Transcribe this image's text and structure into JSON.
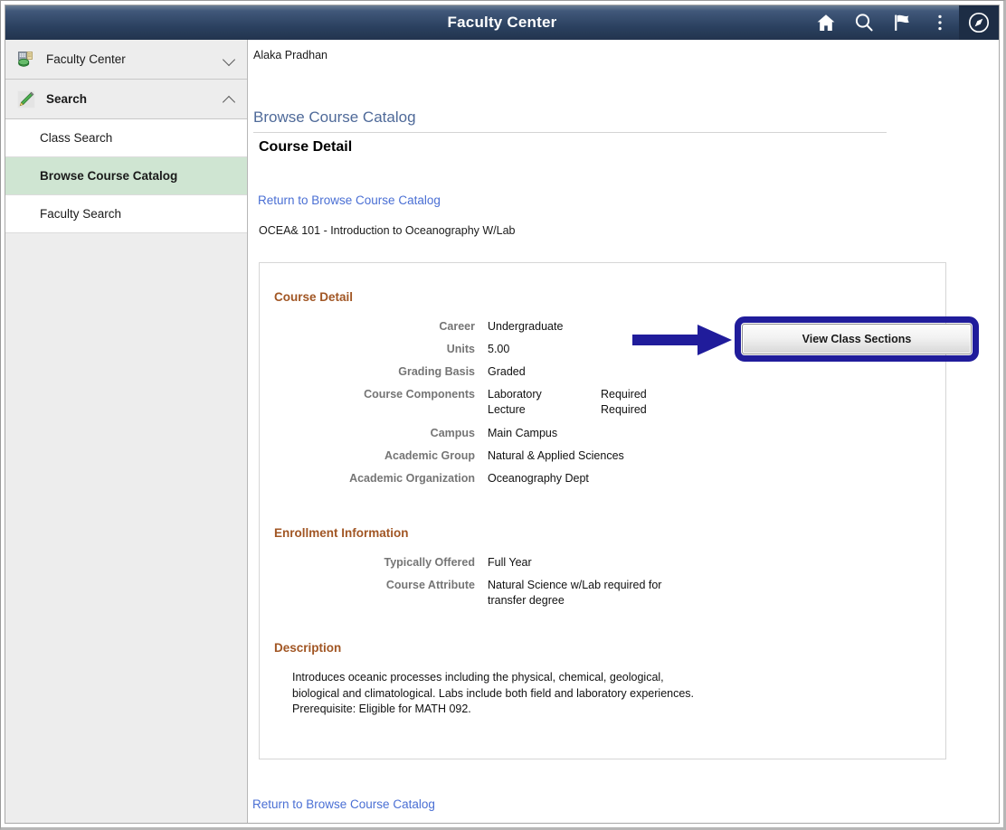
{
  "window": {
    "banner_title": "Faculty Center",
    "banner_icons": [
      {
        "name": "home-icon",
        "label": "Home"
      },
      {
        "name": "search-icon",
        "label": "Search"
      },
      {
        "name": "flag-icon",
        "label": "Notifications"
      },
      {
        "name": "kebab-menu-icon",
        "label": "Actions"
      },
      {
        "name": "compass-icon",
        "label": "NavBar"
      }
    ]
  },
  "sidebar": {
    "groups": [
      {
        "label": "Faculty Center",
        "icon": "faculty-center-icon",
        "expanded": false,
        "chevron": "chevron-down-icon",
        "items": []
      },
      {
        "label": "Search",
        "icon": "pencil-icon",
        "expanded": true,
        "chevron": "chevron-up-icon",
        "items": [
          {
            "label": "Class Search",
            "active": false
          },
          {
            "label": "Browse Course Catalog",
            "active": true
          },
          {
            "label": "Faculty Search",
            "active": false
          }
        ]
      }
    ]
  },
  "main": {
    "user_name": "Alaka Pradhan",
    "page_heading": "Browse Course Catalog",
    "sub_heading": "Course Detail",
    "return_link_top": "Return to Browse Course Catalog",
    "return_link_bottom": "Return to Browse Course Catalog",
    "course_line": "OCEA&  101 - Introduction to Oceanography W/Lab",
    "sections": {
      "course_detail": {
        "title": "Course Detail",
        "fields": [
          {
            "label": "Career",
            "value": "Undergraduate"
          },
          {
            "label": "Units",
            "value": "5.00"
          },
          {
            "label": "Grading Basis",
            "value": "Graded"
          },
          {
            "label": "Course Components",
            "components": [
              {
                "name": "Laboratory",
                "requirement": "Required"
              },
              {
                "name": "Lecture",
                "requirement": "Required"
              }
            ]
          },
          {
            "label": "Campus",
            "value": "Main Campus"
          },
          {
            "label": "Academic Group",
            "value": "Natural & Applied Sciences"
          },
          {
            "label": "Academic Organization",
            "value": "Oceanography Dept"
          }
        ]
      },
      "enrollment_information": {
        "title": "Enrollment Information",
        "fields": [
          {
            "label": "Typically Offered",
            "value": "Full Year"
          },
          {
            "label": "Course Attribute",
            "value_line_1": "Natural Science w/Lab required for",
            "value_line_2": "transfer degree"
          }
        ]
      },
      "description": {
        "title": "Description",
        "line_1": "Introduces oceanic processes including the physical, chemical, geological,",
        "line_2": "biological and climatological. Labs include both field and laboratory experiences.",
        "line_3": "Prerequisite: Eligible for MATH 092."
      }
    },
    "view_class_sections_button": "View Class Sections"
  },
  "colors": {
    "banner_top": "#6b7e94",
    "banner_bottom": "#22344e",
    "section_heading": "#a15624",
    "link": "#4a6fd4",
    "page_heading": "#4f6a99",
    "active_nav": "#cfe5d2",
    "highlight": "#201c9b",
    "label": "#757575"
  }
}
